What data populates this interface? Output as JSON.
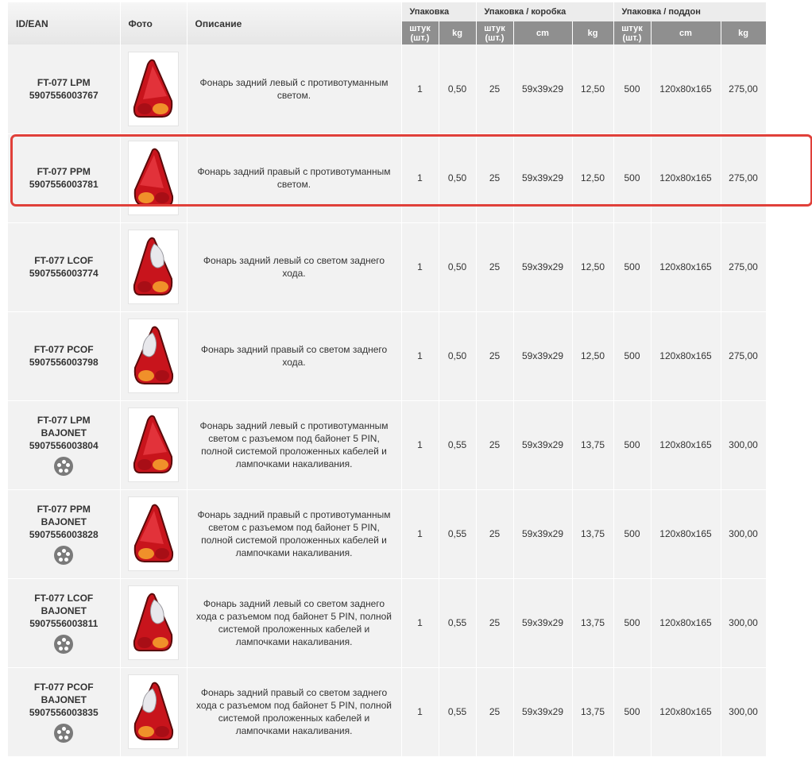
{
  "header": {
    "id_ean": "ID/EAN",
    "photo": "Фото",
    "description": "Описание",
    "groups": {
      "pack": "Упаковка",
      "box": "Упаковка / коробка",
      "pallet": "Упаковка / поддон"
    },
    "sub": {
      "pcs": "штук (шт.)",
      "kg": "kg",
      "cm": "cm"
    }
  },
  "rows": [
    {
      "id": "FT-077 LPM",
      "ean": "5907556003767",
      "desc": "Фонарь задний левый с противотуманным светом.",
      "pack_pcs": "1",
      "pack_kg": "0,50",
      "box_pcs": "25",
      "box_cm": "59x39x29",
      "box_kg": "12,50",
      "pal_pcs": "500",
      "pal_cm": "120x80x165",
      "pal_kg": "275,00",
      "connector": false,
      "lamp": "lpm"
    },
    {
      "id": "FT-077 PPM",
      "ean": "5907556003781",
      "desc": "Фонарь задний правый с противотуманным светом.",
      "pack_pcs": "1",
      "pack_kg": "0,50",
      "box_pcs": "25",
      "box_cm": "59x39x29",
      "box_kg": "12,50",
      "pal_pcs": "500",
      "pal_cm": "120x80x165",
      "pal_kg": "275,00",
      "connector": false,
      "lamp": "ppm"
    },
    {
      "id": "FT-077 LCOF",
      "ean": "5907556003774",
      "desc": "Фонарь задний левый со светом заднего хода.",
      "pack_pcs": "1",
      "pack_kg": "0,50",
      "box_pcs": "25",
      "box_cm": "59x39x29",
      "box_kg": "12,50",
      "pal_pcs": "500",
      "pal_cm": "120x80x165",
      "pal_kg": "275,00",
      "connector": false,
      "lamp": "lcof"
    },
    {
      "id": "FT-077 PCOF",
      "ean": "5907556003798",
      "desc": "Фонарь задний правый со светом заднего хода.",
      "pack_pcs": "1",
      "pack_kg": "0,50",
      "box_pcs": "25",
      "box_cm": "59x39x29",
      "box_kg": "12,50",
      "pal_pcs": "500",
      "pal_cm": "120x80x165",
      "pal_kg": "275,00",
      "connector": false,
      "lamp": "pcof"
    },
    {
      "id": "FT-077 LPM BAJONET",
      "ean": "5907556003804",
      "desc": "Фонарь задний левый с противотуманным светом с разъемом под байонет 5 PIN, полной системой проложенных кабелей и лампочками накаливания.",
      "pack_pcs": "1",
      "pack_kg": "0,55",
      "box_pcs": "25",
      "box_cm": "59x39x29",
      "box_kg": "13,75",
      "pal_pcs": "500",
      "pal_cm": "120x80x165",
      "pal_kg": "300,00",
      "connector": true,
      "lamp": "lpm"
    },
    {
      "id": "FT-077 PPM BAJONET",
      "ean": "5907556003828",
      "desc": "Фонарь задний правый с противотуманным светом с разъемом под байонет 5 PIN, полной системой проложенных кабелей и лампочками накаливания.",
      "pack_pcs": "1",
      "pack_kg": "0,55",
      "box_pcs": "25",
      "box_cm": "59x39x29",
      "box_kg": "13,75",
      "pal_pcs": "500",
      "pal_cm": "120x80x165",
      "pal_kg": "300,00",
      "connector": true,
      "lamp": "ppm"
    },
    {
      "id": "FT-077 LCOF BAJONET",
      "ean": "5907556003811",
      "desc": "Фонарь задний левый со светом заднего хода с разъемом под байонет 5 PIN, полной системой проложенных кабелей и лампочками накаливания.",
      "pack_pcs": "1",
      "pack_kg": "0,55",
      "box_pcs": "25",
      "box_cm": "59x39x29",
      "box_kg": "13,75",
      "pal_pcs": "500",
      "pal_cm": "120x80x165",
      "pal_kg": "300,00",
      "connector": true,
      "lamp": "lcof"
    },
    {
      "id": "FT-077 PCOF BAJONET",
      "ean": "5907556003835",
      "desc": "Фонарь задний правый со светом заднего хода с разъемом под байонет 5 PIN, полной системой проложенных кабелей и лампочками накаливания.",
      "pack_pcs": "1",
      "pack_kg": "0,55",
      "box_pcs": "25",
      "box_cm": "59x39x29",
      "box_kg": "13,75",
      "pal_pcs": "500",
      "pal_cm": "120x80x165",
      "pal_kg": "300,00",
      "connector": true,
      "lamp": "pcof"
    }
  ],
  "highlight": {
    "row_index": 1,
    "color": "#e0403a"
  },
  "icons": {
    "connector": "connector-5pin-icon"
  }
}
